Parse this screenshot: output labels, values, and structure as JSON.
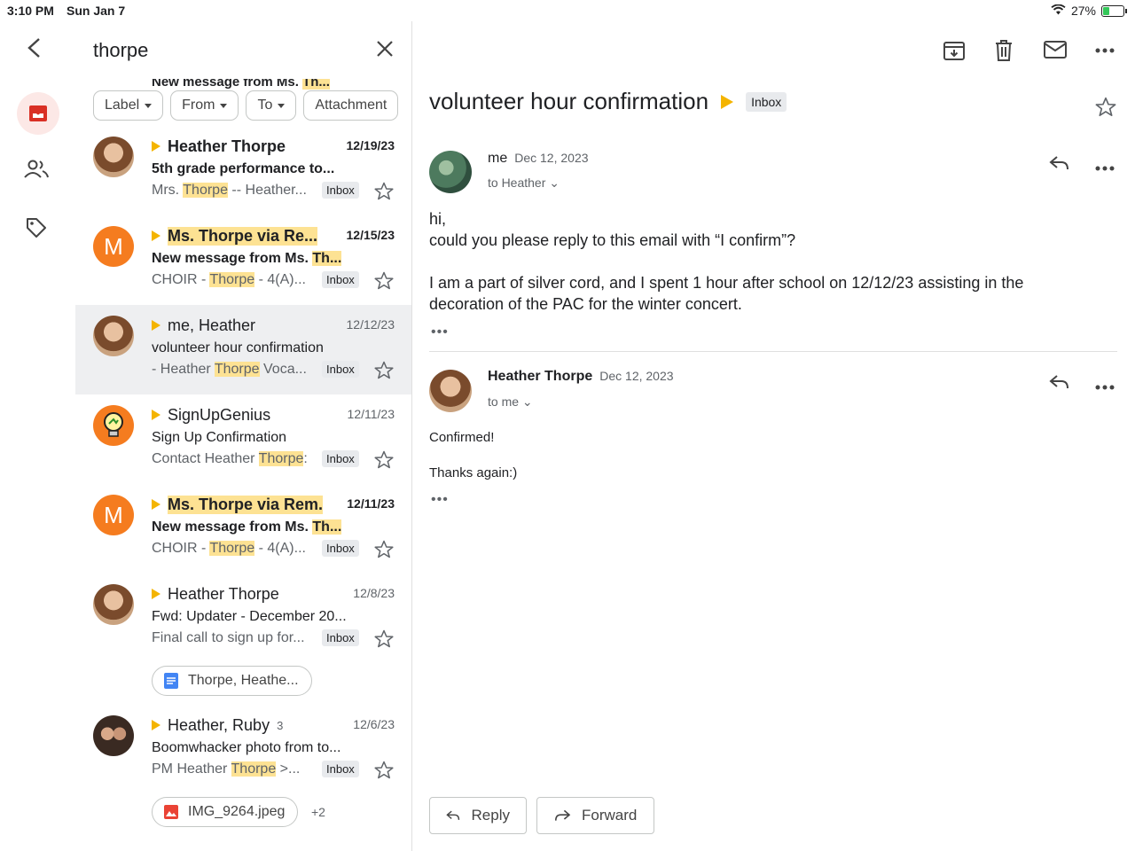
{
  "status": {
    "time": "3:10 PM",
    "date": "Sun Jan 7",
    "battery": "27%"
  },
  "search": {
    "query": "thorpe"
  },
  "peek": {
    "text_plain": "New message from Ms. ",
    "text_hl": "Th..."
  },
  "chips": [
    "Label",
    "From",
    "To",
    "Attachment"
  ],
  "emails": [
    {
      "sender": "Heather Thorpe",
      "date": "12/19/23",
      "subject": "5th grade performance to...",
      "snip_pre": "Mrs. ",
      "snip_hl": "Thorpe",
      "snip_post": " -- Heather...",
      "label": "Inbox",
      "unread": true
    },
    {
      "sender": "Ms. Thorpe via Re...",
      "date": "12/15/23",
      "subject_pre": "New message from Ms. ",
      "subject_hl": "Th...",
      "snip_pre": "CHOIR - ",
      "snip_hl": "Thorpe",
      "snip_post": " - 4(A)...",
      "label": "Inbox",
      "unread": true,
      "avatar_letter": "M"
    },
    {
      "sender": "me, Heather",
      "date": "12/12/23",
      "subject": "volunteer hour confirmation",
      "snip_pre": "- Heather ",
      "snip_hl": "Thorpe",
      "snip_post": " Voca...",
      "label": "Inbox",
      "unread": false
    },
    {
      "sender": "SignUpGenius",
      "date": "12/11/23",
      "subject": "Sign Up Confirmation",
      "snip_pre": "Contact Heather ",
      "snip_hl": "Thorpe",
      "snip_post": ":",
      "label": "Inbox",
      "unread": false
    },
    {
      "sender": "Ms. Thorpe via Rem.",
      "date": "12/11/23",
      "subject_pre": "New message from Ms. ",
      "subject_hl": "Th...",
      "snip_pre": "CHOIR - ",
      "snip_hl": "Thorpe",
      "snip_post": " - 4(A)...",
      "label": "Inbox",
      "unread": true,
      "avatar_letter": "M"
    },
    {
      "sender": "Heather Thorpe",
      "date": "12/8/23",
      "subject": "Fwd: Updater - December 20...",
      "snip_pre": "Final call to sign up for...",
      "snip_hl": "",
      "snip_post": "",
      "label": "Inbox",
      "unread": false,
      "attachment": "Thorpe, Heathe..."
    },
    {
      "sender": "Heather, Ruby",
      "count": "3",
      "date": "12/6/23",
      "subject": "Boomwhacker photo from to...",
      "snip_pre": "PM Heather ",
      "snip_hl": "Thorpe",
      "snip_post": " >...",
      "label": "Inbox",
      "unread": false,
      "attachment": "IMG_9264.jpeg",
      "more_attachments": "+2"
    }
  ],
  "thread": {
    "subject": "volunteer hour confirmation",
    "label": "Inbox",
    "messages": [
      {
        "from": "me",
        "date": "Dec 12, 2023",
        "to": "to Heather",
        "lines": [
          "hi,",
          "could you please reply to this email with “I confirm”?",
          "",
          "I am a part of silver cord, and I spent 1 hour after school on 12/12/23 assisting in the",
          "decoration of the PAC for the winter concert."
        ]
      },
      {
        "from": "Heather Thorpe",
        "date": "Dec 12, 2023",
        "to": "to me",
        "lines": [
          "Confirmed!",
          "Thanks again:)"
        ]
      }
    ],
    "reply_label": "Reply",
    "forward_label": "Forward"
  }
}
